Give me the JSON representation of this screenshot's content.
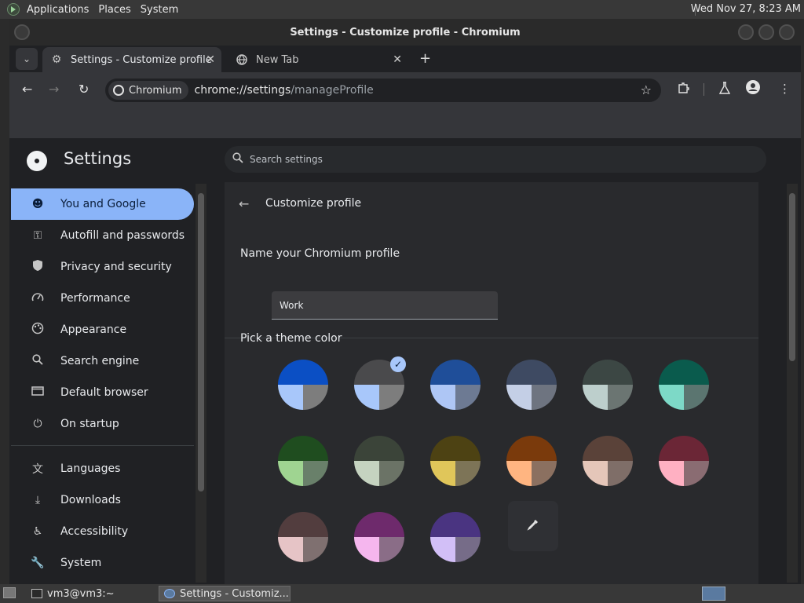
{
  "top_panel": {
    "menus": [
      "Applications",
      "Places",
      "System"
    ],
    "clock": "Wed Nov 27,  8:23 AM"
  },
  "window": {
    "title": "Settings - Customize profile - Chromium"
  },
  "tabs": [
    {
      "label": "Settings - Customize profile",
      "active": true,
      "icon": "gear-icon"
    },
    {
      "label": "New Tab",
      "active": false,
      "icon": "globe-icon"
    }
  ],
  "toolbar": {
    "chip_label": "Chromium",
    "url_host": "chrome://settings",
    "url_path": "/manageProfile"
  },
  "settings": {
    "title": "Settings",
    "search_placeholder": "Search settings"
  },
  "sidebar": {
    "items": [
      {
        "label": "You and Google",
        "icon": "person-icon",
        "selected": true
      },
      {
        "label": "Autofill and passwords",
        "icon": "key-icon",
        "selected": false
      },
      {
        "label": "Privacy and security",
        "icon": "shield-icon",
        "selected": false
      },
      {
        "label": "Performance",
        "icon": "speedometer-icon",
        "selected": false
      },
      {
        "label": "Appearance",
        "icon": "palette-icon",
        "selected": false
      },
      {
        "label": "Search engine",
        "icon": "search-icon",
        "selected": false
      },
      {
        "label": "Default browser",
        "icon": "browser-icon",
        "selected": false
      },
      {
        "label": "On startup",
        "icon": "power-icon",
        "selected": false
      },
      {
        "label": "Languages",
        "icon": "translate-icon",
        "selected": false
      },
      {
        "label": "Downloads",
        "icon": "download-icon",
        "selected": false
      },
      {
        "label": "Accessibility",
        "icon": "accessibility-icon",
        "selected": false
      },
      {
        "label": "System",
        "icon": "wrench-icon",
        "selected": false
      }
    ]
  },
  "main": {
    "page_title": "Customize profile",
    "name_label": "Name your Chromium profile",
    "name_value": "Work",
    "theme_label": "Pick a theme color",
    "theme_colors": [
      {
        "top": "#0b4fc4",
        "left": "#a8c7fa",
        "right": "#7d7d7d",
        "selected": false
      },
      {
        "top": "#4a4a4c",
        "left": "#a8c7fa",
        "right": "#7d7d7d",
        "selected": true
      },
      {
        "top": "#1f4e99",
        "left": "#aec6f5",
        "right": "#6d7a93",
        "selected": false
      },
      {
        "top": "#3e4a62",
        "left": "#c4cfe6",
        "right": "#6e7480",
        "selected": false
      },
      {
        "top": "#3c4744",
        "left": "#bdcfcc",
        "right": "#6b7572",
        "selected": false
      },
      {
        "top": "#0a5b4d",
        "left": "#7dd9c7",
        "right": "#5b7570",
        "selected": false
      },
      {
        "top": "#1f4d1f",
        "left": "#9fd491",
        "right": "#69806a",
        "selected": false
      },
      {
        "top": "#3b4439",
        "left": "#c5d3c0",
        "right": "#6b7366",
        "selected": false
      },
      {
        "top": "#4d4213",
        "left": "#e0c65a",
        "right": "#7d7457",
        "selected": false
      },
      {
        "top": "#7a3a0c",
        "left": "#ffb581",
        "right": "#8b7060",
        "selected": false
      },
      {
        "top": "#5a4239",
        "left": "#e5c6b9",
        "right": "#7f6e68",
        "selected": false
      },
      {
        "top": "#6b2636",
        "left": "#ffb0c2",
        "right": "#8a6c72",
        "selected": false
      },
      {
        "top": "#523d3e",
        "left": "#e6c4c6",
        "right": "#7f7070",
        "selected": false
      },
      {
        "top": "#6e2a6c",
        "left": "#f5b6ee",
        "right": "#8a6d87",
        "selected": false
      },
      {
        "top": "#4a3481",
        "left": "#d2bff7",
        "right": "#766c88",
        "selected": false
      }
    ]
  },
  "taskbar": {
    "tasks": [
      {
        "label": "vm3@vm3:~",
        "active": false
      },
      {
        "label": "Settings - Customiz...",
        "active": true
      }
    ]
  }
}
